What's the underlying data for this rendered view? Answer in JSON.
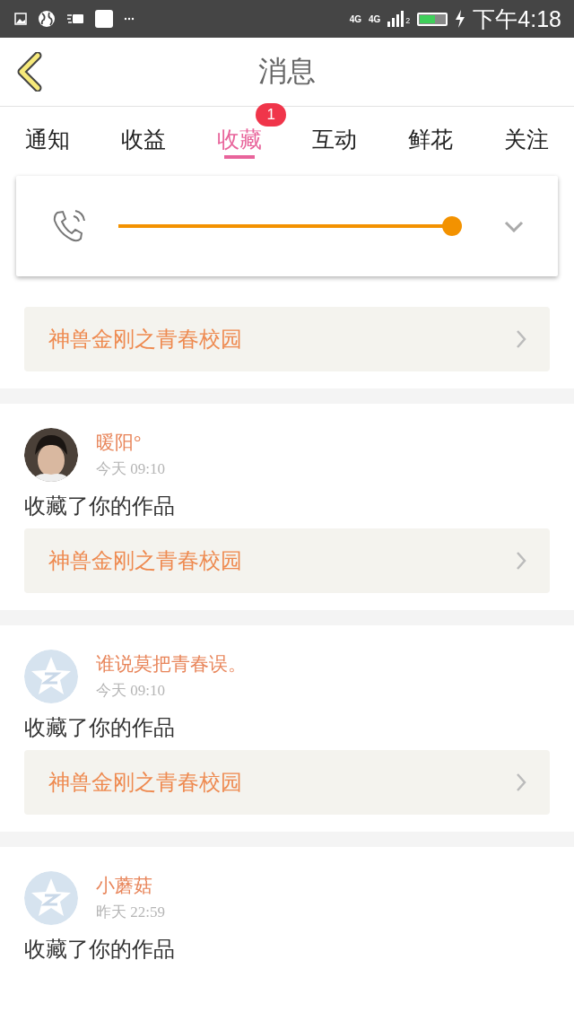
{
  "status_bar": {
    "network": [
      "4G",
      "4G"
    ],
    "sim": "2",
    "time": "下午4:18"
  },
  "header": {
    "title": "消息"
  },
  "tabs": [
    {
      "label": "通知",
      "selected": false
    },
    {
      "label": "收益",
      "selected": false
    },
    {
      "label": "收藏",
      "selected": true,
      "badge": "1"
    },
    {
      "label": "互动",
      "selected": false
    },
    {
      "label": "鲜花",
      "selected": false
    },
    {
      "label": "关注",
      "selected": false
    }
  ],
  "volume_popup": {
    "level": 0.97
  },
  "items": [
    {
      "kind": "partial",
      "work": "神兽金刚之青春校园"
    },
    {
      "kind": "full",
      "user": "暖阳°",
      "time": "今天 09:10",
      "action": "收藏了你的作品",
      "work": "神兽金刚之青春校园"
    },
    {
      "kind": "full",
      "avatar": {
        "kind": "default"
      },
      "user": "谁说莫把青春误。",
      "time": "今天 09:10",
      "action": "收藏了你的作品",
      "work": "神兽金刚之青春校园"
    },
    {
      "kind": "full",
      "avatar": {
        "kind": "default"
      },
      "user": "小蘑菇",
      "time": "昨天 22:59",
      "action": "收藏了你的作品"
    }
  ]
}
